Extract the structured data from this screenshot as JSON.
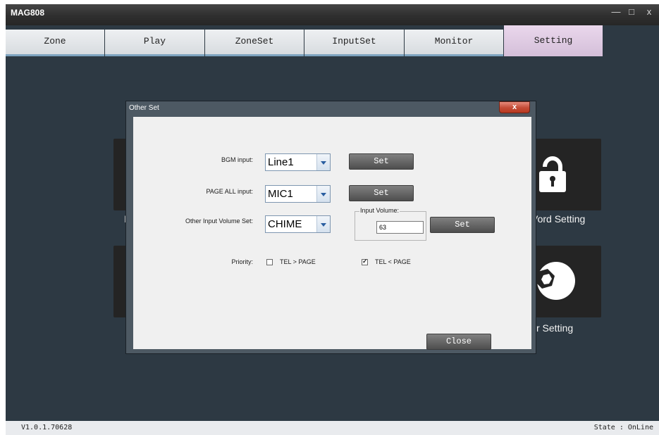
{
  "window": {
    "title": "MAG808",
    "minimize": "—",
    "maximize": "□",
    "close": "x"
  },
  "tabs": [
    {
      "label": "Zone"
    },
    {
      "label": "Play"
    },
    {
      "label": "ZoneSet"
    },
    {
      "label": "InputSet"
    },
    {
      "label": "Monitor"
    },
    {
      "label": "Setting"
    }
  ],
  "background_tiles": {
    "password_label": "Vord Setting",
    "other_label": "r Setting",
    "left_label_fragment": "I"
  },
  "dialog": {
    "title": "Other Set",
    "close_x": "x",
    "bgm_label": "BGM input:",
    "bgm_value": "Line1",
    "page_all_label": "PAGE ALL input:",
    "page_all_value": "MIC1",
    "other_volume_label": "Other Input Volume Set:",
    "other_volume_value": "CHIME",
    "input_volume_group": "Input Volume:",
    "input_volume_value": "63",
    "set_label": "Set",
    "priority_label": "Priority:",
    "priority_options": [
      {
        "label": "TEL > PAGE",
        "checked": false
      },
      {
        "label": "TEL < PAGE",
        "checked": true
      }
    ],
    "close_button": "Close"
  },
  "status": {
    "version": "V1.0.1.70628",
    "state": "State : OnLine"
  }
}
